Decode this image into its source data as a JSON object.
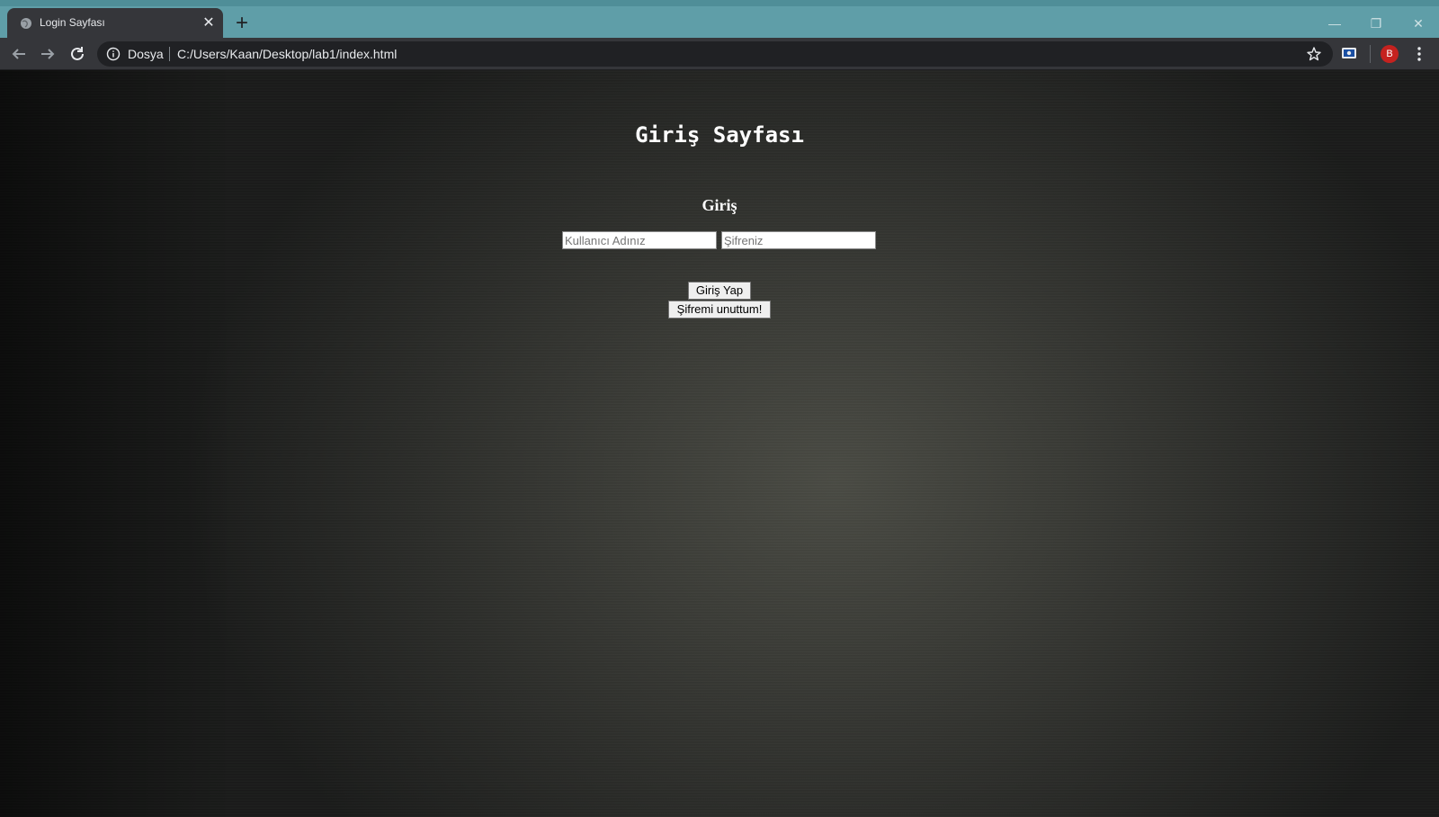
{
  "browser": {
    "tab": {
      "title": "Login Sayfası",
      "favicon": "globe-icon",
      "close_symbol": "✕"
    },
    "new_tab_symbol": "+",
    "window_controls": {
      "minimize": "—",
      "restore": "❐",
      "close": "✕"
    },
    "toolbar": {
      "scheme_label": "Dosya",
      "url": "C:/Users/Kaan/Desktop/lab1/index.html",
      "profile_initial": "B"
    },
    "colors": {
      "tabstrip": "#5f9ea8",
      "toolbar": "#35363a",
      "avatar": "#c5221f"
    }
  },
  "page": {
    "title": "Giriş Sayfası",
    "form": {
      "heading": "Giriş",
      "username_placeholder": "Kullanıcı Adınız",
      "password_placeholder": "Şifreniz",
      "login_button": "Giriş Yap",
      "forgot_button": "Şifremi unuttum!"
    }
  }
}
